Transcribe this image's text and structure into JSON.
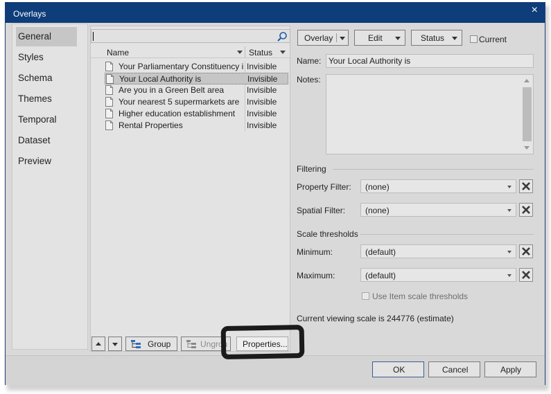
{
  "window": {
    "title": "Overlays",
    "close_glyph": "×"
  },
  "nav": {
    "items": [
      {
        "label": "General",
        "active": true
      },
      {
        "label": "Styles"
      },
      {
        "label": "Schema"
      },
      {
        "label": "Themes"
      },
      {
        "label": "Temporal"
      },
      {
        "label": "Dataset"
      },
      {
        "label": "Preview"
      }
    ]
  },
  "search": {
    "value": "",
    "icon": "search-icon"
  },
  "list": {
    "columns": {
      "name": "Name",
      "status": "Status"
    },
    "rows": [
      {
        "name": "Your Parliamentary Constituency is",
        "status": "Invisible"
      },
      {
        "name": "Your Local Authority is",
        "status": "Invisible",
        "selected": true
      },
      {
        "name": "Are you in a Green Belt area",
        "status": "Invisible"
      },
      {
        "name": "Your nearest 5 supermarkets are",
        "status": "Invisible"
      },
      {
        "name": "Higher education establishment",
        "status": "Invisible"
      },
      {
        "name": "Rental Properties",
        "status": "Invisible"
      }
    ]
  },
  "left_footer": {
    "group_label": "Group",
    "ungroup_label": "Ungrou",
    "properties_label": "Properties..."
  },
  "toolbar": {
    "overlay_label": "Overlay",
    "edit_label": "Edit",
    "status_label": "Status",
    "current_label": "Current"
  },
  "details": {
    "name_label": "Name:",
    "name_value": "Your Local Authority is",
    "notes_label": "Notes:",
    "filtering_heading": "Filtering",
    "property_filter_label": "Property Filter:",
    "property_filter_value": "(none)",
    "spatial_filter_label": "Spatial Filter:",
    "spatial_filter_value": "(none)",
    "scale_heading": "Scale thresholds",
    "minimum_label": "Minimum:",
    "minimum_value": "(default)",
    "maximum_label": "Maximum:",
    "maximum_value": "(default)",
    "use_item_scale_label": "Use Item scale thresholds",
    "current_scale_text": "Current viewing scale is 244776 (estimate)"
  },
  "dialog_buttons": {
    "ok": "OK",
    "cancel": "Cancel",
    "apply": "Apply"
  }
}
